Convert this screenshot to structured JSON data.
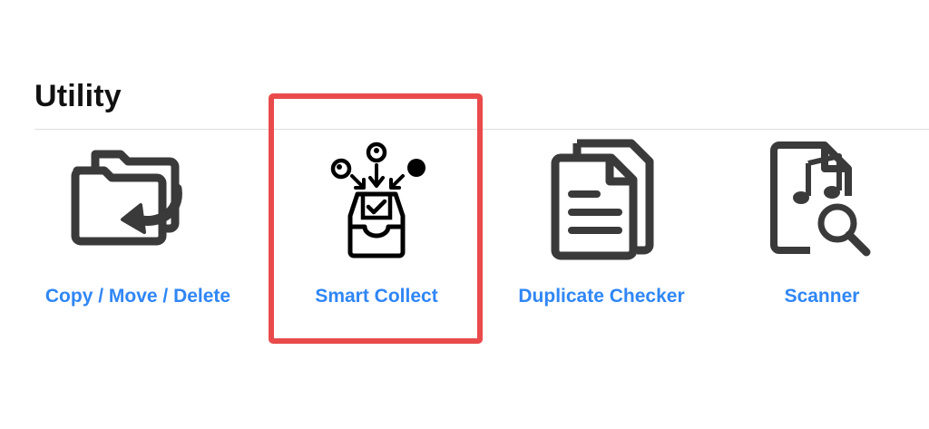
{
  "section": {
    "title": "Utility"
  },
  "tools": [
    {
      "label": "Copy / Move / Delete",
      "icon": "folders-arrow-icon"
    },
    {
      "label": "Smart Collect",
      "icon": "inbox-collect-icon"
    },
    {
      "label": "Duplicate Checker",
      "icon": "duplicate-documents-icon"
    },
    {
      "label": "Scanner",
      "icon": "music-file-search-icon"
    }
  ],
  "colors": {
    "label": "#2f86f6",
    "icon": "#3a3a3a",
    "highlight": "#e94b4b",
    "title": "#111111",
    "divider": "#dedede"
  },
  "selected_tool": "Smart Collect"
}
